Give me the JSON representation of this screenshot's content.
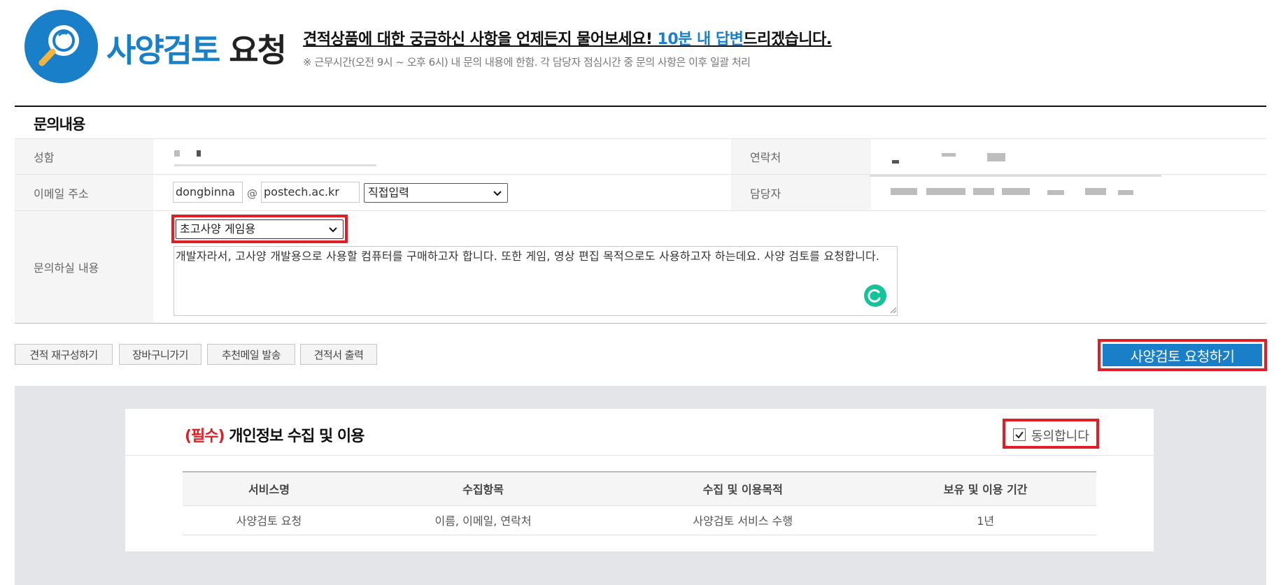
{
  "header": {
    "title_part1": "사양검토",
    "title_part2": "요청",
    "headline_pre": "견적상품에 대한 궁금하신 사항을 언제든지 물어보세요! ",
    "headline_highlight": "10분 내 답변",
    "headline_post": "드리겠습니다.",
    "note": "※ 근무시간(오전 9시 ~ 오후 6시) 내 문의 내용에 한함. 각 담당자 점심시간 중 문의 사항은 이후 일괄 처리"
  },
  "form": {
    "section_title": "문의내용",
    "name_label": "성함",
    "contact_label": "연락처",
    "email_label": "이메일 주소",
    "email_local": "dongbinna",
    "email_at": "@",
    "email_domain": "postech.ac.kr",
    "email_domain_select": "직접입력",
    "manager_label": "담당자",
    "inquiry_label": "문의하실 내용",
    "inquiry_type": "초고사양 게임용",
    "inquiry_text": "개발자라서, 고사양 개발용으로 사용할 컴퓨터를 구매하고자 합니다. 또한 게임, 영상 편집 목적으로도 사용하고자 하는데요. 사양 검토를 요청합니다."
  },
  "actions": {
    "rebuild": "견적 재구성하기",
    "cart": "장바구니가기",
    "send_mail": "추천메일 발송",
    "print": "견적서 출력",
    "submit": "사양검토 요청하기"
  },
  "privacy": {
    "required": "(필수)",
    "title": " 개인정보 수집 및 이용",
    "agree_label": "동의합니다",
    "agree_checked": true,
    "headers": [
      "서비스명",
      "수집항목",
      "수집 및 이용목적",
      "보유 및 이용 기간"
    ],
    "rows": [
      [
        "사양검토 요청",
        "이름, 이메일, 연락처",
        "사양검토 서비스 수행",
        "1년"
      ]
    ]
  },
  "colors": {
    "brand_blue": "#1a7fc9",
    "highlight_red": "#e01e26"
  }
}
